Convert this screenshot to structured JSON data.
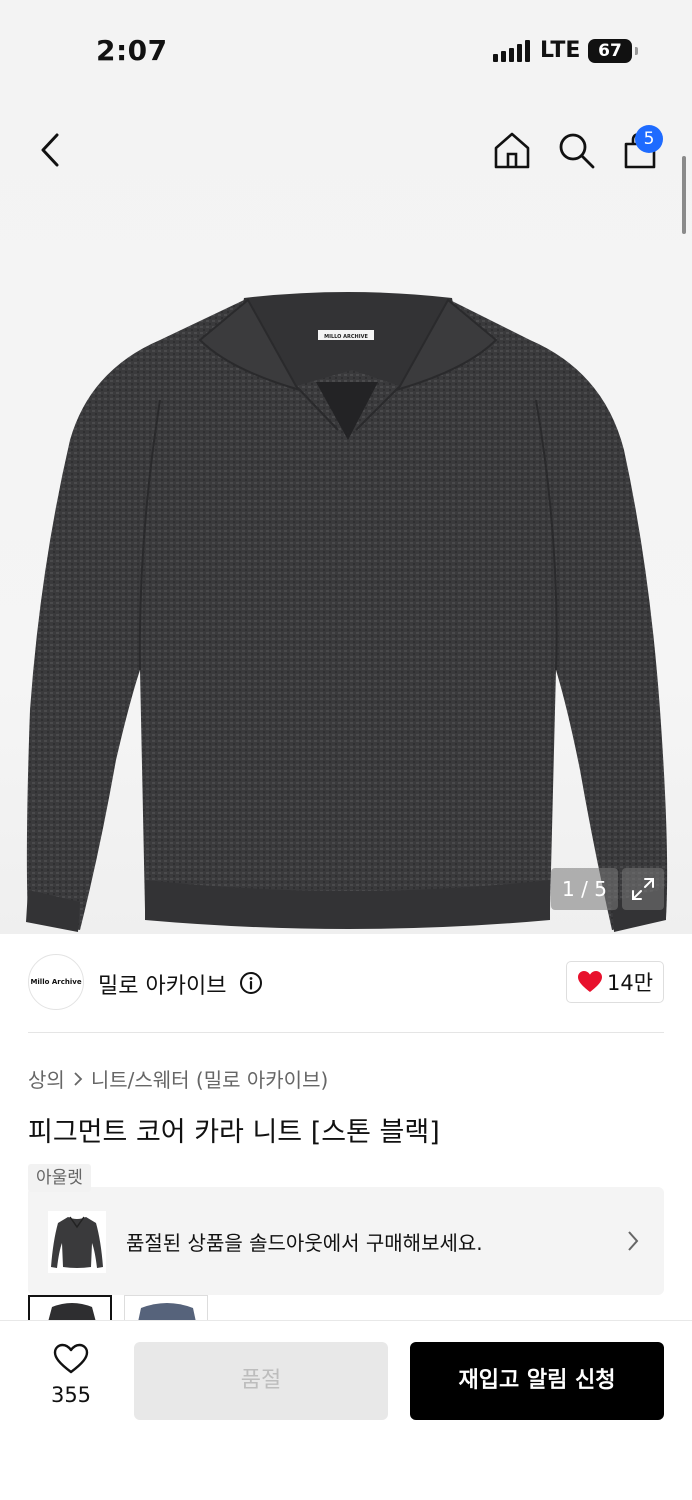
{
  "status_bar": {
    "time": "2:07",
    "network": "LTE",
    "battery": "67"
  },
  "header": {
    "cart_count": "5"
  },
  "gallery": {
    "product_label": "MILLO ARCHIVE",
    "counter": "1 / 5"
  },
  "brand": {
    "logo_text": "Millo Archive",
    "name": "밀로 아카이브",
    "like_count": "14만"
  },
  "breadcrumb": {
    "category": "상의",
    "subcategory": "니트/스웨터 (밀로 아카이브)"
  },
  "product": {
    "title": "피그먼트 코어 카라 니트 [스톤 블랙]"
  },
  "outlet": {
    "tag": "아울렛",
    "message": "품절된 상품을 솔드아웃에서 구매해보세요."
  },
  "bottom_bar": {
    "wish_count": "355",
    "soldout_label": "품절",
    "restock_label": "재입고 알림 신청"
  },
  "colors": {
    "accent": "#1e6bff",
    "heart": "#e8112d",
    "cta": "#000000"
  }
}
